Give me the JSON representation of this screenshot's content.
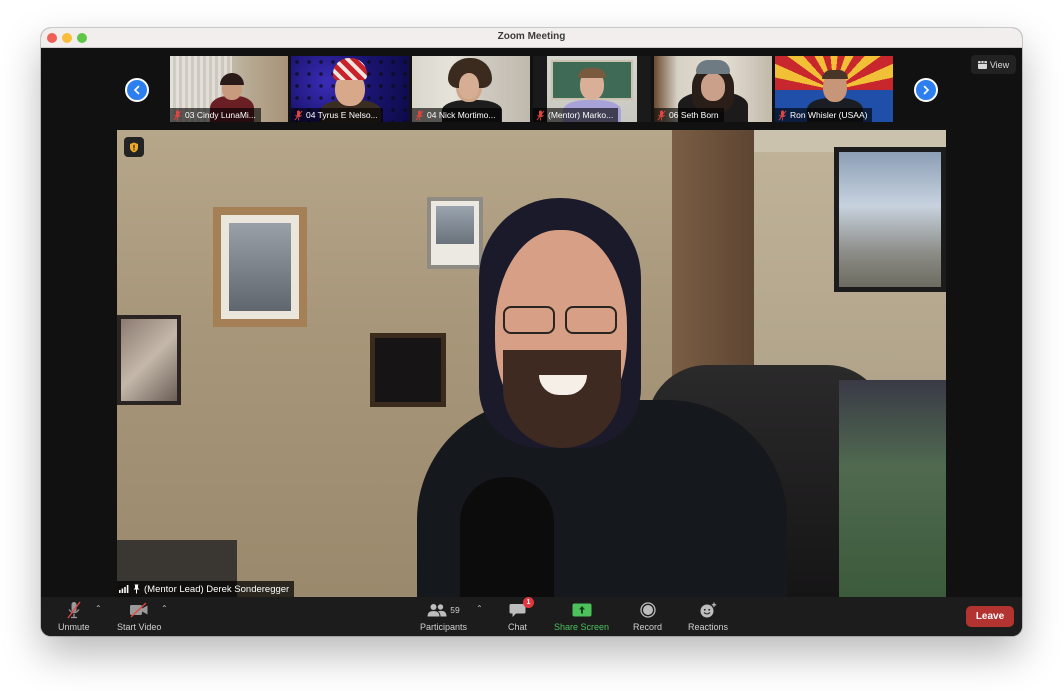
{
  "window": {
    "title": "Zoom Meeting"
  },
  "header": {
    "view_label": "View",
    "view_icon": "grid-view-icon",
    "prev_icon": "chevron-left-icon",
    "next_icon": "chevron-right-icon"
  },
  "gallery": {
    "participants": [
      {
        "name": "03 Cindy LunaMi...",
        "muted": true
      },
      {
        "name": "04 Tyrus E Nelso...",
        "muted": true
      },
      {
        "name": "04 Nick Mortimo...",
        "muted": true
      },
      {
        "name": "(Mentor) Marko...",
        "muted": true
      },
      {
        "name": "06 Seth Born",
        "muted": true
      },
      {
        "name": "Ron Whisler (USAA)",
        "muted": true
      }
    ]
  },
  "active_speaker": {
    "name": "(Mentor Lead) Derek Sonderegger",
    "security_icon": "shield-icon",
    "signal_icon": "signal-bars-icon",
    "pin_icon": "pin-icon"
  },
  "toolbar": {
    "unmute_label": "Unmute",
    "start_video_label": "Start Video",
    "participants_label": "Participants",
    "participants_count": "59",
    "chat_label": "Chat",
    "chat_unread": "1",
    "share_label": "Share Screen",
    "record_label": "Record",
    "reactions_label": "Reactions",
    "leave_label": "Leave"
  },
  "colors": {
    "accent_blue": "#2d7ff0",
    "share_green": "#4cc15c",
    "leave_red": "#b33331",
    "badge_red": "#e2373f",
    "muted_red": "#e0463f"
  }
}
